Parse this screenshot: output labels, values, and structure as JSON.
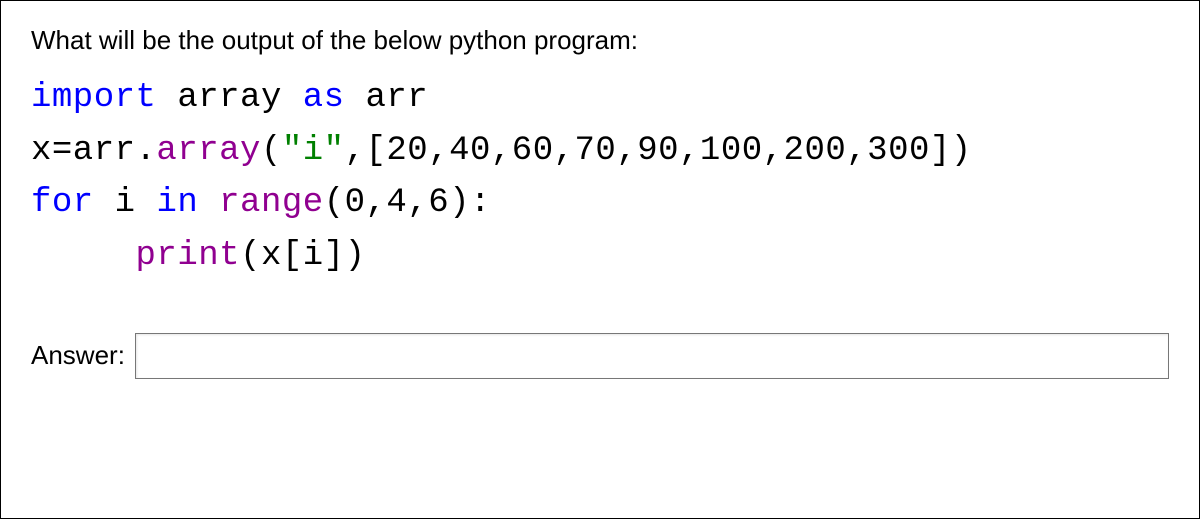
{
  "question": "What will be the output of the below python program:",
  "code": {
    "line1": {
      "import_kw": "import",
      "module": " array ",
      "as_kw": "as",
      "alias": " arr"
    },
    "line2": {
      "prefix": "x=arr.",
      "func": "array",
      "paren_open": "(",
      "str": "\"i\"",
      "rest": ",[20,40,60,70,90,100,200,300])"
    },
    "line3": {
      "for_kw": "for",
      "mid": " i ",
      "in_kw": "in",
      "space": " ",
      "range_fn": "range",
      "args": "(0,4,6):"
    },
    "line4": {
      "indent": "     ",
      "print_fn": "print",
      "args": "(x[i])"
    }
  },
  "answer_label": "Answer:",
  "answer_value": ""
}
